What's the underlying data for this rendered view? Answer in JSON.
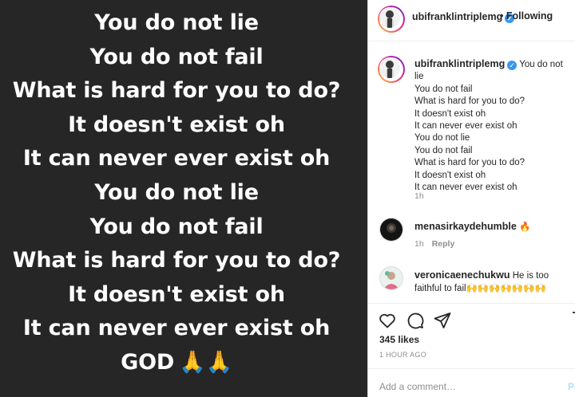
{
  "image": {
    "lines": [
      "You do not lie",
      "You do not fail",
      "What is hard for you to do?",
      "It doesn't exist oh",
      "It can never ever exist oh",
      "You do not lie",
      "You do not fail",
      "What is hard for you to do?",
      "It doesn't exist oh",
      "It can never ever exist oh"
    ],
    "last_line": "GOD",
    "last_line_emoji": "🙏🙏"
  },
  "header": {
    "username": "ubifranklintriplemg",
    "verified_mark": "✓",
    "separator": "•",
    "follow_label": "Following"
  },
  "caption": {
    "username": "ubifranklintriplemg",
    "first_line": "You do not lie",
    "lines": [
      "You do not fail",
      "What is hard for you to do?",
      "It doesn't exist oh",
      "It can never ever exist oh",
      "You do not lie",
      "You do not fail",
      "What is hard for you to do?",
      "It doesn't exist oh",
      "It can never ever exist oh"
    ],
    "time": "1h"
  },
  "comments": [
    {
      "username": "menasirkaydehumble",
      "text": "🔥",
      "time": "1h",
      "reply_label": "Reply"
    },
    {
      "username": "veronicaenechukwu",
      "text": "He is too faithful to fail🙌🙌🙌🙌🙌🙌🙌"
    }
  ],
  "likes": "345 likes",
  "posted": "1 HOUR AGO",
  "add_comment_placeholder": "Add a comment…",
  "post_label": "Post",
  "colors": {
    "image_bg": "#262626",
    "verified": "#3897f0",
    "muted": "#8e8e8e"
  }
}
